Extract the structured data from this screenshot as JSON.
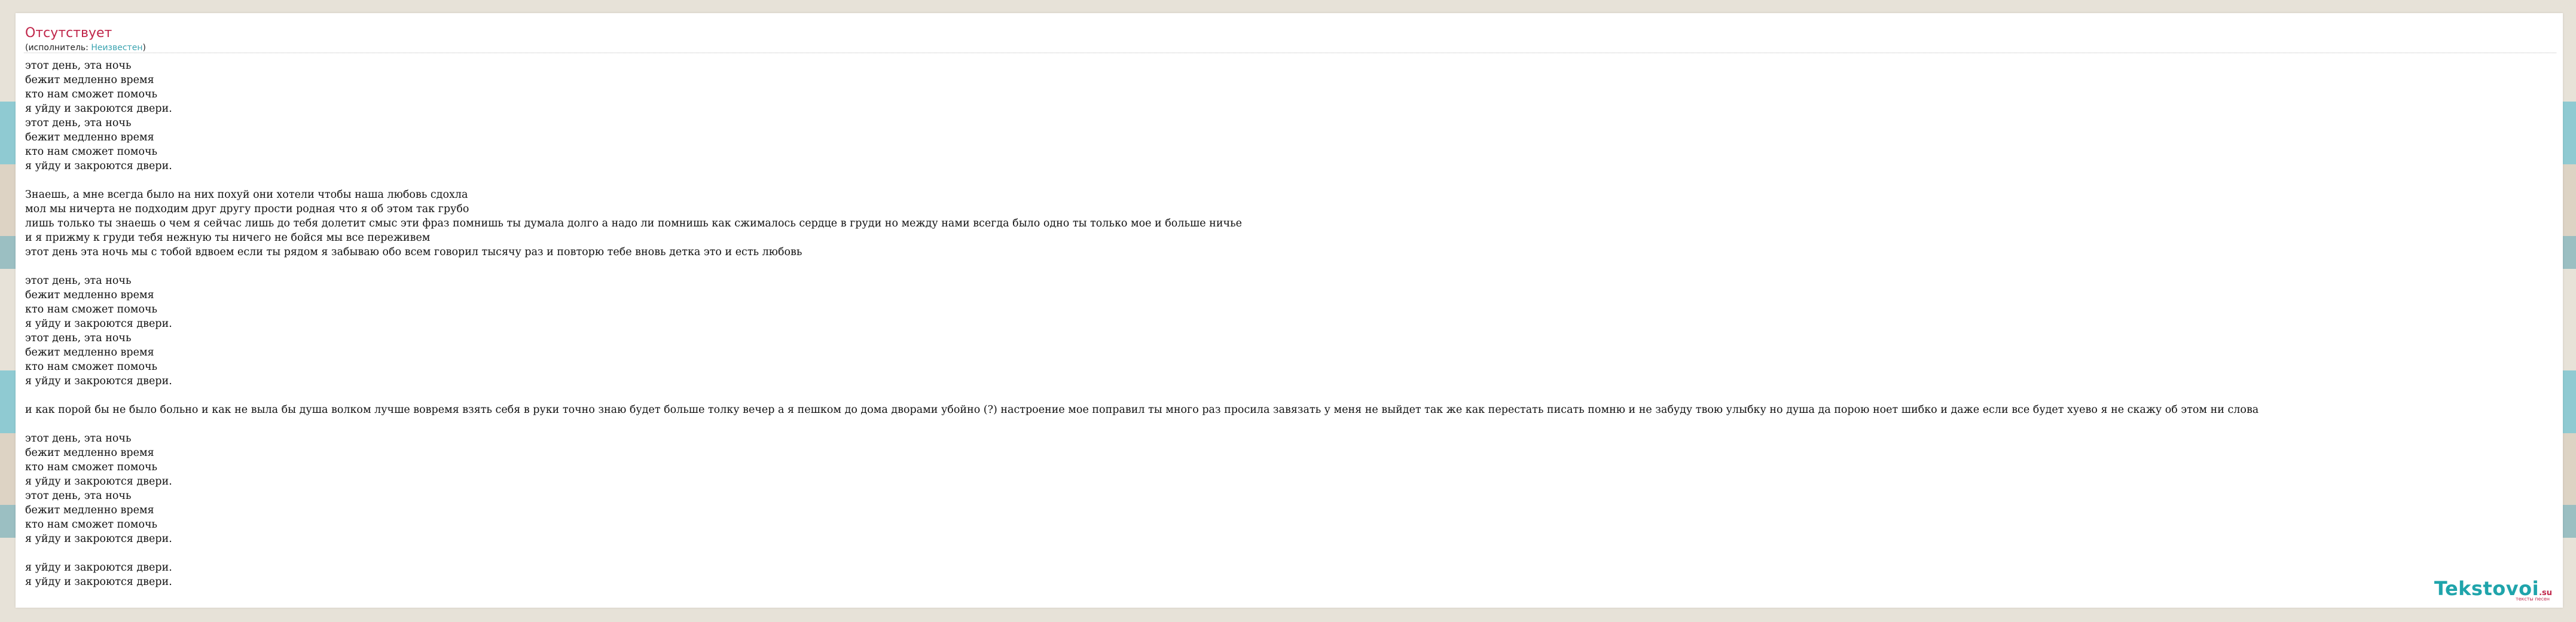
{
  "page": {
    "title": "Отсутствует",
    "performer_prefix": "(исполнитель: ",
    "performer_name": "Неизвестен",
    "performer_suffix": ")"
  },
  "lyrics": [
    "этот день, эта ночь",
    "бежит медленно время",
    "кто нам сможет помочь",
    "я уйду и закроются двери.",
    "этот день, эта ночь",
    "бежит медленно время",
    "кто нам сможет помочь",
    "я уйду и закроются двери.",
    "",
    "Знаешь, а мне всегда было на них похуй они хотели чтобы наша любовь сдохла",
    "мол мы ничерта не подходим друг другу прости родная что я об этом так грубо",
    "лишь только ты знаешь о чем я сейчас лишь до тебя долетит смыс эти фраз помнишь ты думала долго а надо ли помнишь как сжималось сердце в груди но между нами всегда было одно ты только мое и больше ничье",
    "и я прижму к груди тебя нежную ты ничего не бойся мы все переживем",
    "этот день эта ночь мы с тобой вдвоем если ты рядом я забываю обо всем говорил тысячу раз и повторю тебе вновь детка это и есть любовь",
    "",
    "этот день, эта ночь",
    "бежит медленно время",
    "кто нам сможет помочь",
    "я уйду и закроются двери.",
    "этот день, эта ночь",
    "бежит медленно время",
    "кто нам сможет помочь",
    "я уйду и закроются двери.",
    "",
    "и как порой бы не было больно и как не выла бы душа волком лучше вовремя взять себя в руки точно знаю будет больше толку вечер а я пешком до дома дворами убойно (?) настроение мое поправил ты много раз просила завязать у меня не выйдет так же как перестать писать помню и не забуду твою улыбку но душа да порою ноет шибко и даже если все будет хуево я не скажу об этом ни слова",
    "",
    "этот день, эта ночь",
    "бежит медленно время",
    "кто нам сможет помочь",
    "я уйду и закроются двери.",
    "этот день, эта ночь",
    "бежит медленно время",
    "кто нам сможет помочь",
    "я уйду и закроются двери.",
    "",
    "я уйду и закроются двери.",
    "я уйду и закроются двери."
  ],
  "logo": {
    "word": "Tekstovoi",
    "tld": ".su",
    "tagline": "тексты песен"
  },
  "colors": {
    "title": "#c0264a",
    "link": "#3aa3b0",
    "logo": "#1fa4ab",
    "background": "#e7e2d8"
  }
}
